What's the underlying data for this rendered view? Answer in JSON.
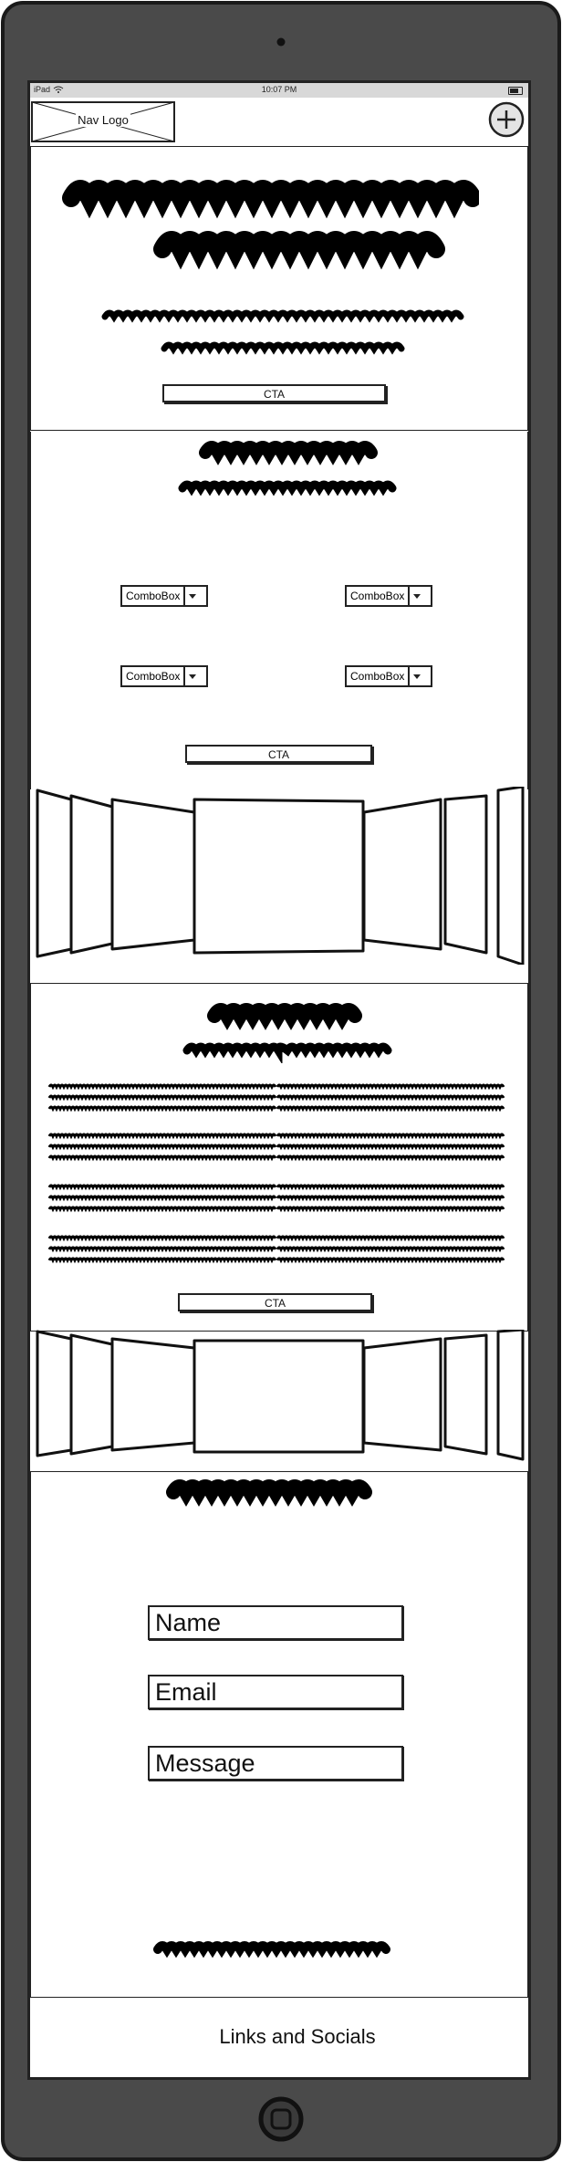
{
  "status_bar": {
    "device": "iPad",
    "time": "10:07 PM"
  },
  "nav": {
    "logo": "Nav Logo",
    "add_icon": "plus-circle-icon"
  },
  "hero": {
    "cta": "CTA"
  },
  "filters": {
    "combos": [
      "ComboBox",
      "ComboBox",
      "ComboBox",
      "ComboBox"
    ],
    "cta": "CTA"
  },
  "about": {
    "cta": "CTA"
  },
  "contact": {
    "name_placeholder": "Name",
    "email_placeholder": "Email",
    "message_placeholder": "Message"
  },
  "footer": {
    "text": "Links and Socials"
  },
  "icons": {
    "camera": "camera-dot-icon",
    "home": "home-button-icon",
    "wifi": "wifi-icon",
    "battery": "battery-icon",
    "carousel": "cover-flow-carousel"
  },
  "colors": {
    "device_frame": "#4a4a4a",
    "device_border": "#1a1a1a",
    "status_bar": "#d8d8d8",
    "ink": "#111111"
  }
}
